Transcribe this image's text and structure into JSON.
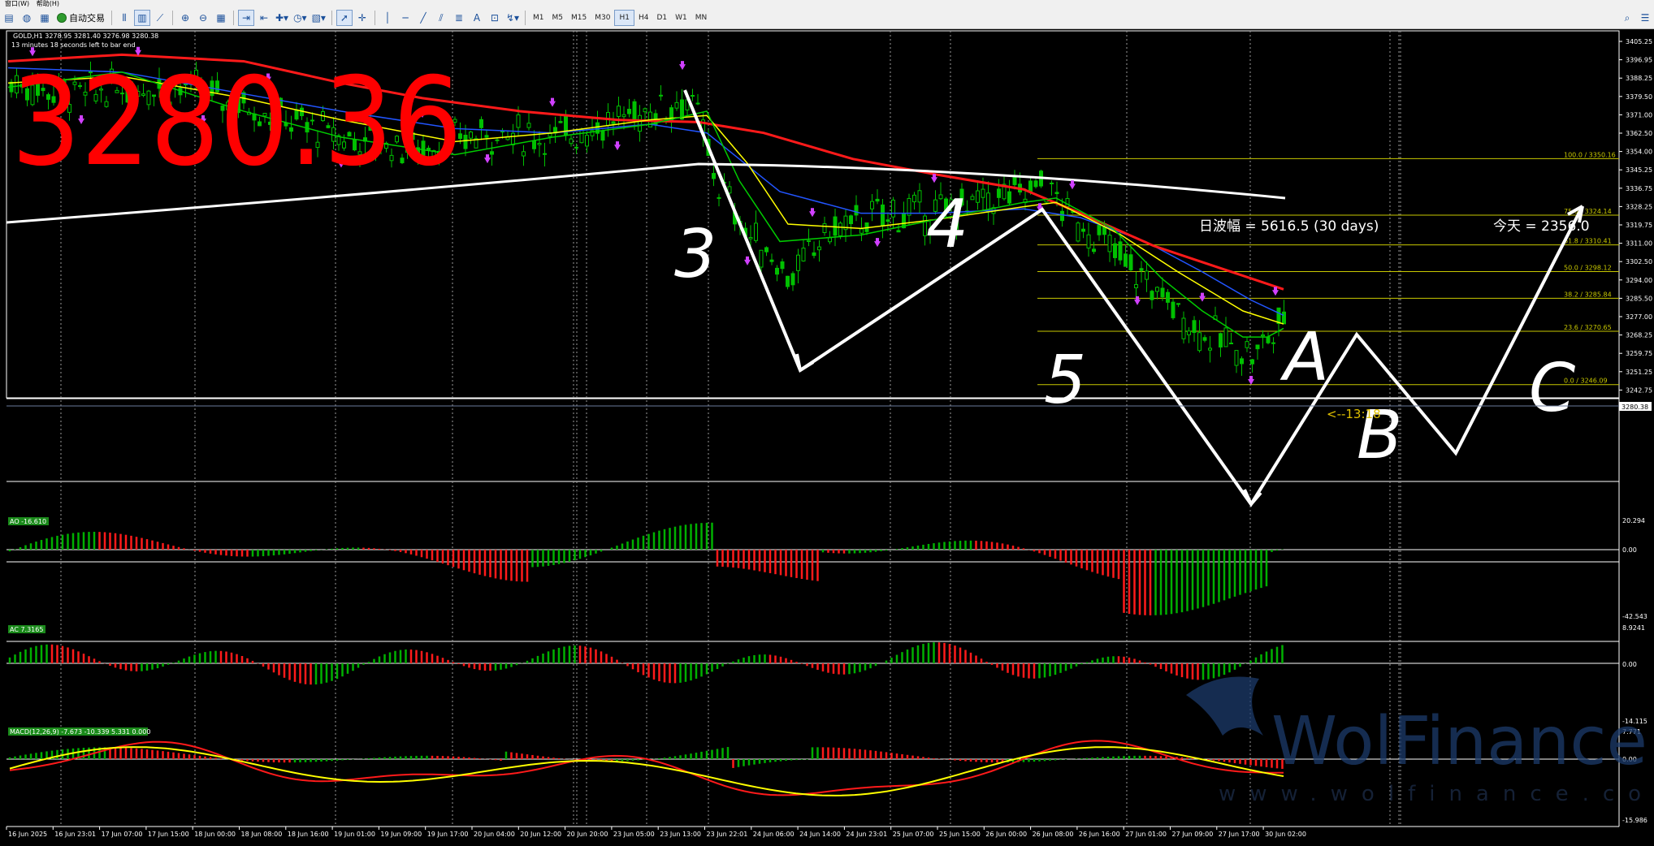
{
  "menu": {
    "items": [
      "窗口(W)",
      "帮助(H)"
    ]
  },
  "toolbar": {
    "autotrade_label": "自动交易",
    "timeframes": [
      "M1",
      "M5",
      "M15",
      "M30",
      "H1",
      "H4",
      "D1",
      "W1",
      "MN"
    ],
    "active_timeframe": "H1",
    "tools": [
      "new-chart-icon",
      "profiles-icon",
      "navigator-icon",
      "autotrade-icon",
      "bar-chart-icon",
      "candle-chart-icon",
      "line-chart-icon",
      "zoom-in-icon",
      "zoom-out-icon",
      "tile-icon",
      "scroll-icon",
      "autoscroll-icon",
      "indicators-icon",
      "periods-icon",
      "templates-icon",
      "cursor-icon",
      "crosshair-icon",
      "vline-icon",
      "hline-icon",
      "trendline-icon",
      "channel-icon",
      "fibo-icon",
      "text-icon",
      "label-icon",
      "arrows-icon",
      "search-icon",
      "account-icon"
    ]
  },
  "chart": {
    "symbol_info": "GOLD,H1  3278.95 3281.40 3276.98 3280.38",
    "bar_timer": "13 minutes 18 seconds left to bar end",
    "big_price": "3280.36",
    "stats_text": "日波幅 = 5616.5  (30 days)",
    "today_text": "今天 = 2356.0",
    "countdown_label": "<--13:18",
    "current_price_label": "3280.38",
    "wave_labels": [
      "3",
      "4",
      "5",
      "A",
      "B",
      "C"
    ],
    "price_axis": [
      "3405.25",
      "3396.95",
      "3388.25",
      "3379.50",
      "3371.00",
      "3362.50",
      "3354.00",
      "3345.25",
      "3336.75",
      "3328.25",
      "3319.75",
      "3311.00",
      "3302.50",
      "3294.00",
      "3285.50",
      "3277.00",
      "3268.25",
      "3259.75",
      "3251.25",
      "3242.75"
    ],
    "fibo_levels": [
      {
        "label": "100.0 / 3350.16",
        "price": 3350.16
      },
      {
        "label": "75.0 / 3324.14",
        "price": 3324.14
      },
      {
        "label": "61.8 / 3310.41",
        "price": 3310.41
      },
      {
        "label": "50.0 / 3298.12",
        "price": 3298.12
      },
      {
        "label": "38.2 / 3285.84",
        "price": 3285.84
      },
      {
        "label": "23.6 / 3270.65",
        "price": 3270.65
      },
      {
        "label": "0.0 / 3246.09",
        "price": 3246.09
      }
    ],
    "colors": {
      "fibo": "#c8c800",
      "ma_red": "#ff1a1a",
      "ma_blue": "#2255ff",
      "ma_yellow": "#ffff00",
      "ma_green": "#00cc00",
      "white_line": "#ffffff",
      "candle": "#00c000",
      "big_price": "#ff0000"
    }
  },
  "indicators": {
    "ao": {
      "label": "AO -16.610",
      "max": "20.294",
      "zero": "0.00",
      "min": "-42.543"
    },
    "ac": {
      "label": "AC 7.3165",
      "max": "8.9241",
      "zero": "0.00",
      "min": "-14.115"
    },
    "macd": {
      "label": "MACD(12,26,9) -7.673 -10.339 5.331 0.000",
      "max": "7.771",
      "zero": "0.00",
      "min": "-15.986"
    }
  },
  "time_axis": [
    "16 Jun 2025",
    "16 Jun 23:01",
    "17 Jun 07:00",
    "17 Jun 15:00",
    "18 Jun 00:00",
    "18 Jun 08:00",
    "18 Jun 16:00",
    "19 Jun 01:00",
    "19 Jun 09:00",
    "19 Jun 17:00",
    "20 Jun 04:00",
    "20 Jun 12:00",
    "20 Jun 20:00",
    "23 Jun 05:00",
    "23 Jun 13:00",
    "23 Jun 22:01",
    "24 Jun 06:00",
    "24 Jun 14:00",
    "24 Jun 23:01",
    "25 Jun 07:00",
    "25 Jun 15:00",
    "26 Jun 00:00",
    "26 Jun 08:00",
    "26 Jun 16:00",
    "27 Jun 01:00",
    "27 Jun 09:00",
    "27 Jun 17:00",
    "30 Jun 02:00"
  ],
  "watermark": {
    "brand": "WolFinance",
    "url": "www.wolfinance.com"
  }
}
